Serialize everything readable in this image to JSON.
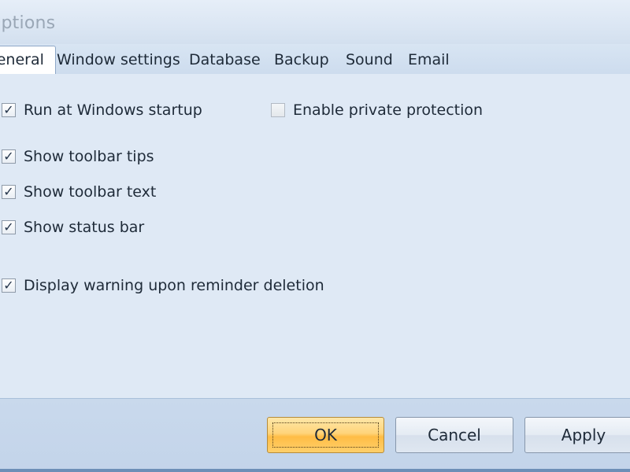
{
  "window": {
    "title": "Options"
  },
  "tabs": [
    {
      "label": "General",
      "active": true
    },
    {
      "label": "Window settings",
      "active": false
    },
    {
      "label": "Database",
      "active": false
    },
    {
      "label": "Backup",
      "active": false
    },
    {
      "label": "Sound",
      "active": false
    },
    {
      "label": "Email",
      "active": false
    }
  ],
  "general": {
    "run_at_startup": {
      "label": "Run at Windows startup",
      "checked": true
    },
    "private_protection": {
      "label": "Enable private protection",
      "checked": false
    },
    "toolbar_tips": {
      "label": "Show toolbar tips",
      "checked": true
    },
    "toolbar_text": {
      "label": "Show toolbar text",
      "checked": true
    },
    "status_bar": {
      "label": "Show status bar",
      "checked": true
    },
    "warn_on_delete": {
      "label": "Display warning upon reminder deletion",
      "checked": true
    }
  },
  "buttons": {
    "ok": "OK",
    "cancel": "Cancel",
    "apply": "Apply"
  },
  "glyphs": {
    "check": "✓"
  },
  "colors": {
    "default_button": "#ffc95a",
    "window_bg": "#dfe9f5",
    "footer_bg": "#c6d7eb"
  }
}
